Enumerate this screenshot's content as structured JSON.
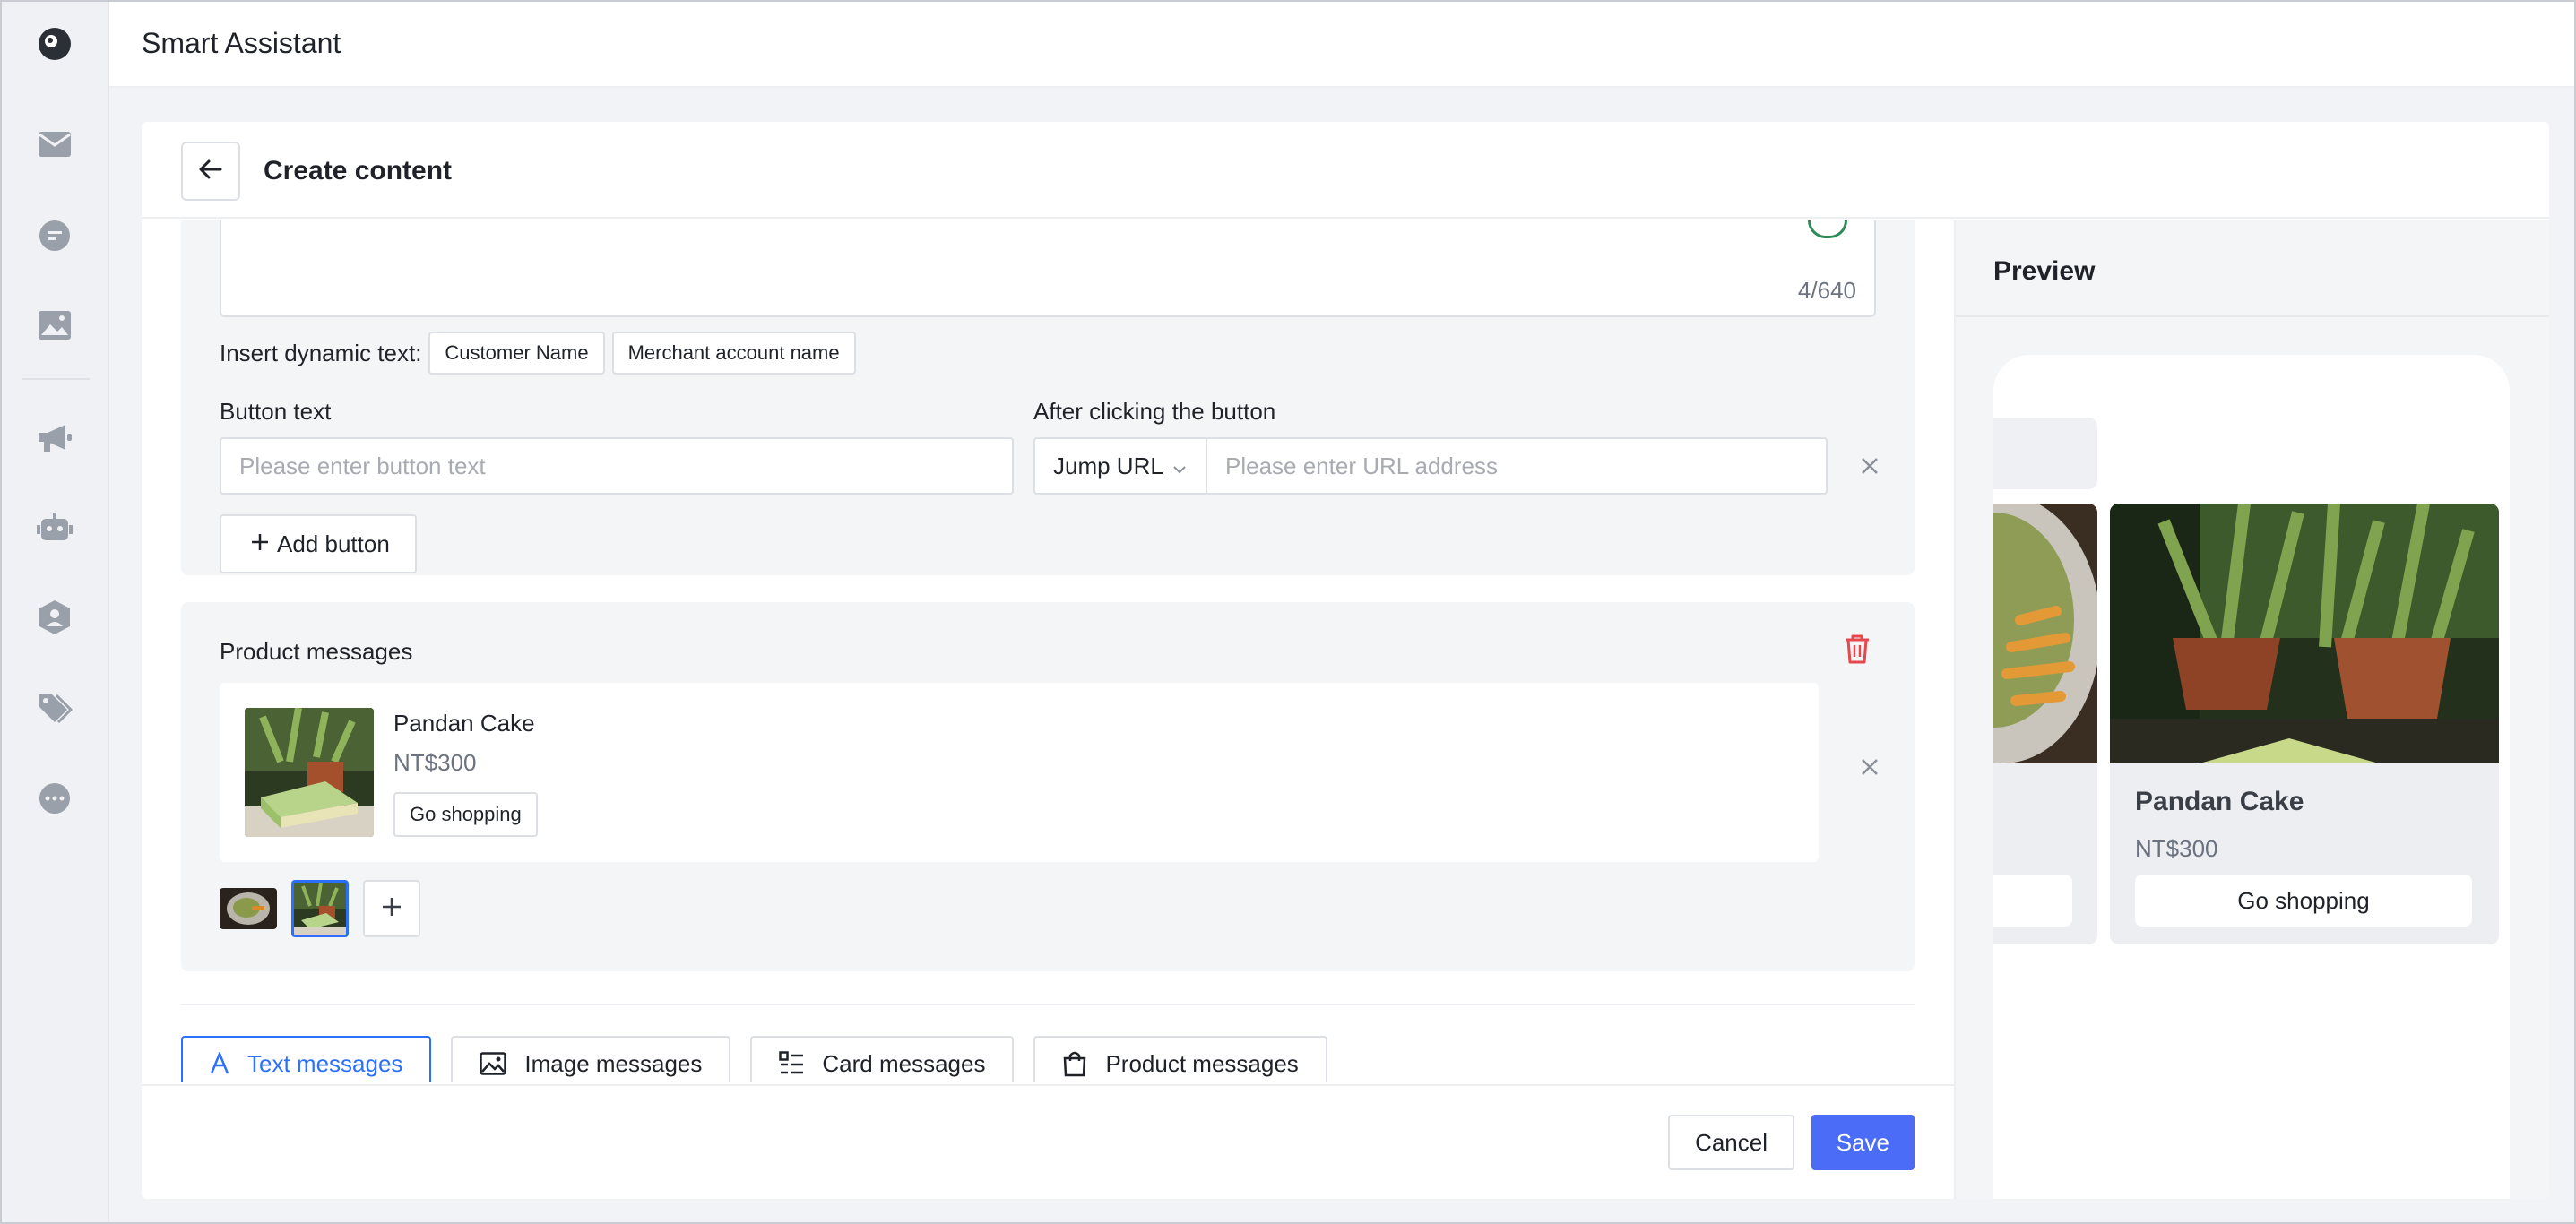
{
  "app": {
    "title": "Smart Assistant"
  },
  "rail": {
    "icons": [
      "logo-icon",
      "mail-icon",
      "chat-icon",
      "image-icon",
      "megaphone-icon",
      "robot-icon",
      "user-settings-icon",
      "tag-icon",
      "more-icon"
    ]
  },
  "page": {
    "title": "Create content",
    "back_icon": "arrow-left-icon"
  },
  "text_section": {
    "counter": "4/640",
    "dynamic_label": "Insert dynamic text:",
    "dynamic_chips": [
      "Customer Name",
      "Merchant account name"
    ],
    "button_text_label": "Button text",
    "button_text_placeholder": "Please enter button text",
    "after_click_label": "After clicking the button",
    "action_select": "Jump URL",
    "url_placeholder": "Please enter URL address",
    "add_button_label": "Add button"
  },
  "product_section": {
    "title": "Product messages",
    "product": {
      "name": "Pandan Cake",
      "price": "NT$300",
      "button": "Go shopping"
    }
  },
  "tabs": [
    {
      "label": "Text messages",
      "icon": "text-icon",
      "active": true
    },
    {
      "label": "Image messages",
      "icon": "image-icon",
      "active": false
    },
    {
      "label": "Card messages",
      "icon": "list-icon",
      "active": false
    },
    {
      "label": "Product messages",
      "icon": "bag-icon",
      "active": false
    }
  ],
  "footer": {
    "cancel": "Cancel",
    "save": "Save"
  },
  "preview": {
    "title": "Preview",
    "card": {
      "name": "Pandan Cake",
      "price": "NT$300",
      "button": "Go shopping"
    }
  },
  "colors": {
    "accent": "#2b6fff",
    "primary_button": "#4a6cf7",
    "danger": "#e5484d",
    "annotation_arrow": "#e53c2e"
  }
}
